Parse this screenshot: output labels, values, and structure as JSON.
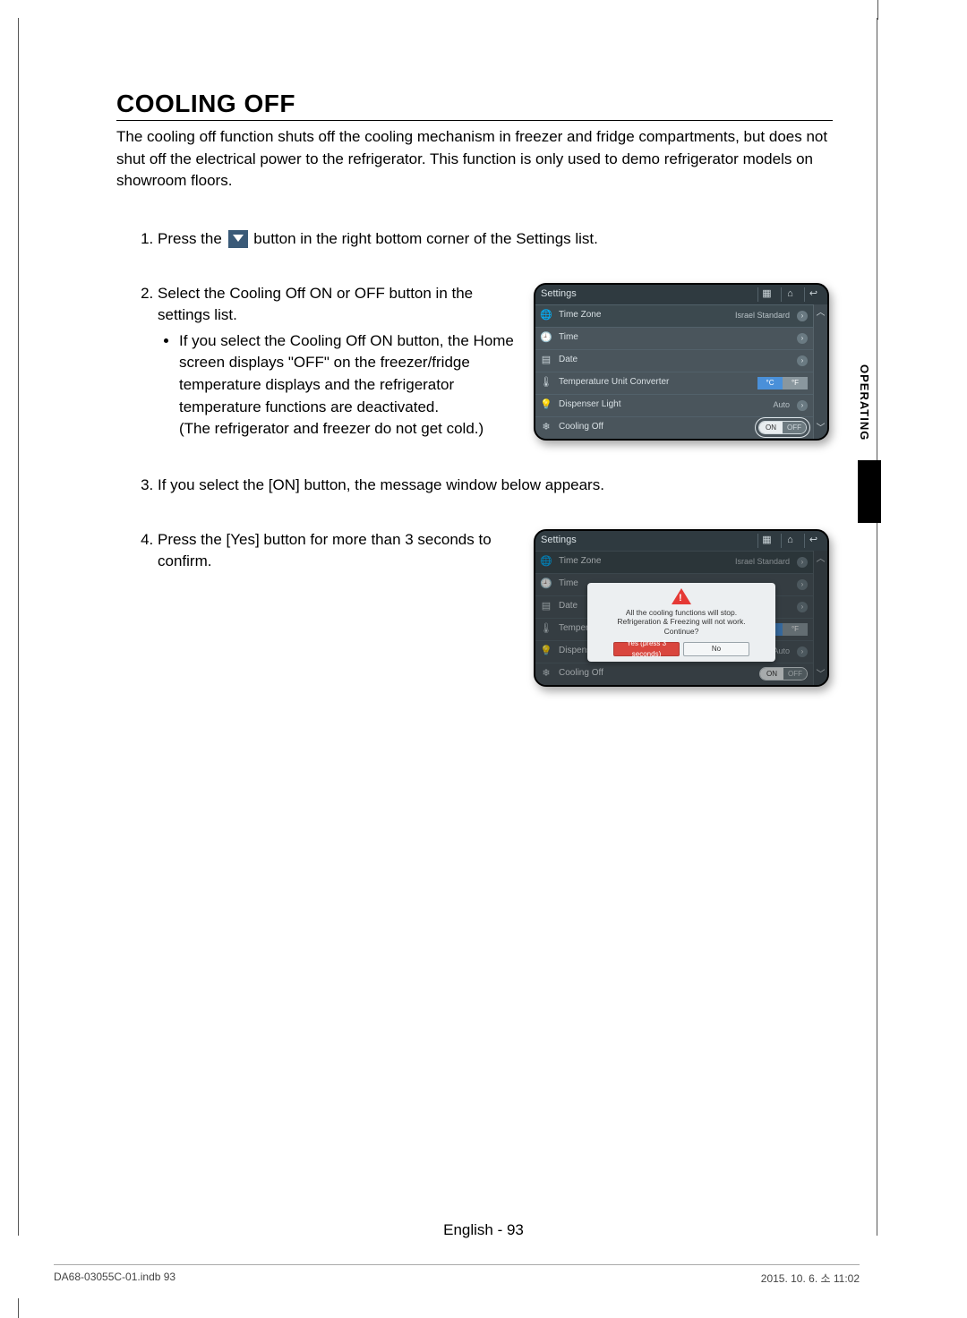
{
  "heading": "COOLING OFF",
  "intro": "The cooling off function shuts off the cooling mechanism in freezer and fridge compartments, but does not shut off the electrical power to the refrigerator. This function is only used to demo refrigerator models on showroom floors.",
  "steps": {
    "s1a": "Press the ",
    "s1b": " button in the right bottom corner of the Settings list.",
    "s2": "Select the Cooling Off ON or OFF button in the settings list.",
    "s2_bullet": "If you select the Cooling Off ON button, the Home screen displays \"OFF\" on the freezer/fridge temperature displays and the refrigerator temperature functions are deactivated.",
    "s2_note": "(The refrigerator and freezer do not get cold.)",
    "s3": "If you select the [ON] button, the message window below appears.",
    "s4": "Press the [Yes] button for more than 3 seconds to confirm."
  },
  "side_tab": "OPERATING",
  "page_label": "English - 93",
  "footer_left": "DA68-03055C-01.indb   93",
  "footer_right": "2015. 10. 6.   소 11:02",
  "settings": {
    "title": "Settings",
    "rows": [
      {
        "icon": "globe",
        "label": "Time Zone",
        "value": "Israel Standard",
        "arrow": true
      },
      {
        "icon": "clock",
        "label": "Time",
        "value": "",
        "arrow": true
      },
      {
        "icon": "calendar",
        "label": "Date",
        "value": "",
        "arrow": true
      },
      {
        "icon": "thermo",
        "label": "Temperature Unit Converter",
        "unit_c": "°C",
        "unit_f": "°F"
      },
      {
        "icon": "bulb",
        "label": "Dispenser Light",
        "value": "Auto",
        "arrow": true
      },
      {
        "icon": "snow",
        "label": "Cooling Off",
        "on": "ON",
        "off": "OFF"
      }
    ]
  },
  "modal": {
    "line1": "All the cooling functions will stop.",
    "line2": "Refrigeration & Freezing will not work.",
    "line3": "Continue?",
    "yes": "Yes (press 3 seconds)",
    "no": "No"
  }
}
